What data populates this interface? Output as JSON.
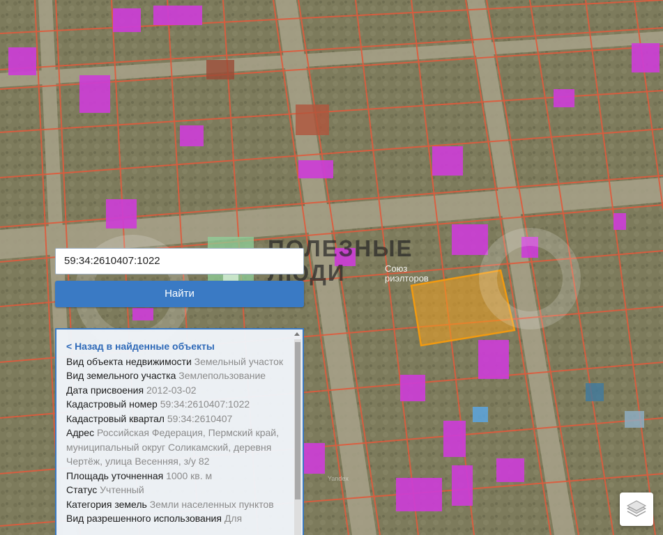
{
  "search": {
    "value": "59:34:2610407:1022"
  },
  "find_button": {
    "label": "Найти"
  },
  "panel": {
    "back_link": "< Назад в найденные объекты",
    "fields": [
      {
        "label": "Вид объекта недвижимости",
        "value": "Земельный участок"
      },
      {
        "label": "Вид земельного участка",
        "value": "Землепользование"
      },
      {
        "label": "Дата присвоения",
        "value": "2012-03-02"
      },
      {
        "label": "Кадастровый номер",
        "value": "59:34:2610407:1022"
      },
      {
        "label": "Кадастровый квартал",
        "value": "59:34:2610407"
      },
      {
        "label": "Адрес",
        "value": "Российская Федерация, Пермский край, муниципальный округ Соликамский, деревня Чертёж, улица Весенняя, з/у 82"
      },
      {
        "label": "Площадь уточненная",
        "value": "1000 кв. м"
      },
      {
        "label": "Статус",
        "value": "Учтенный"
      },
      {
        "label": "Категория земель",
        "value": "Земли населенных пунктов"
      },
      {
        "label": "Вид разрешенного использования",
        "value": "Для"
      }
    ]
  },
  "watermark": {
    "line1": "ПОЛЕЗНЫЕ",
    "line2": "ЛЮДИ",
    "sub1": "Союз",
    "sub2": "риэлторов"
  },
  "map": {
    "boundary_color": "#e05a3c",
    "building_color": "#cc3ed6",
    "selected_parcel_color": "#f0a020",
    "ground_color": "#7f7d5e",
    "copyright_mark": "Yandex"
  },
  "icons": {
    "layers": "layers-icon"
  }
}
